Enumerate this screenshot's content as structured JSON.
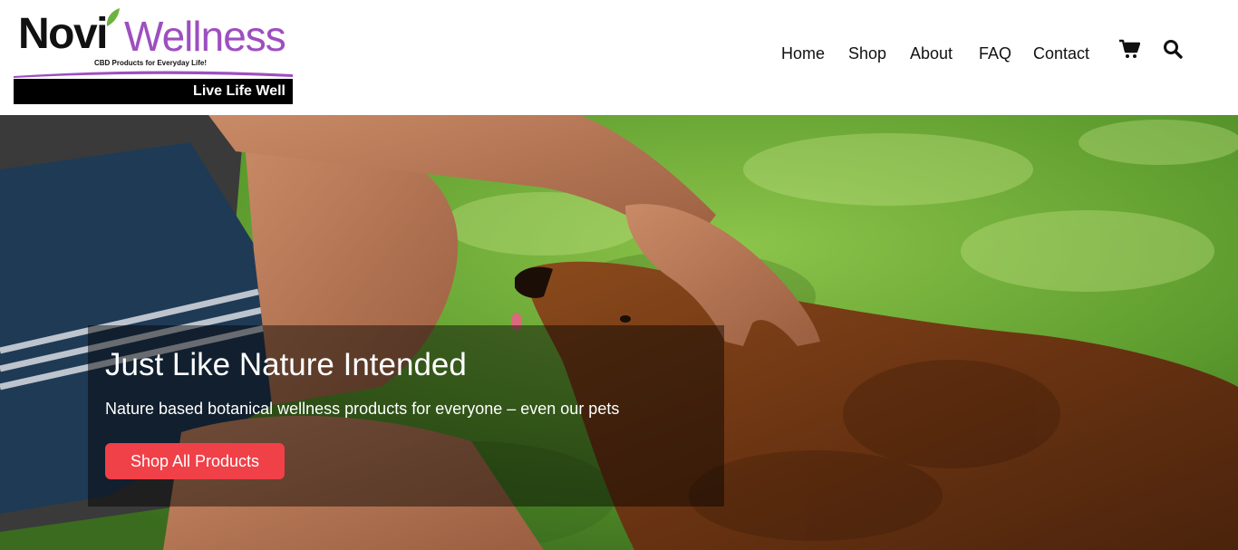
{
  "logo": {
    "brand_dark": "Novi",
    "brand_color": "Wellness",
    "tagline": "CBD Products for Everyday Life!",
    "band_text": "Live Life Well",
    "accent_color": "#9d4fc0"
  },
  "nav": {
    "items": [
      {
        "label": "Home"
      },
      {
        "label": "Shop"
      },
      {
        "label": "About"
      },
      {
        "label": "FAQ"
      },
      {
        "label": "Contact"
      }
    ],
    "icons": [
      "cart-icon",
      "search-icon"
    ]
  },
  "hero": {
    "title": "Just Like Nature Intended",
    "subtitle": "Nature based botanical wellness products for everyone – even our pets",
    "button_label": "Shop All Products",
    "button_color": "#f04048"
  }
}
